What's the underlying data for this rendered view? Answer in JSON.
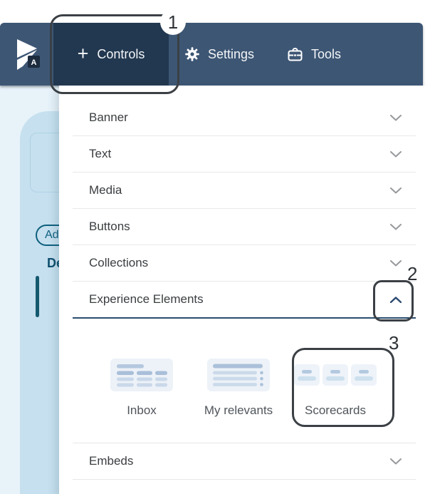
{
  "navbar": {
    "logo_badge": "A",
    "plus_glyph": "+",
    "tabs": [
      {
        "label": "Controls",
        "icon": "plus",
        "active": true
      },
      {
        "label": "Settings",
        "icon": "gear",
        "active": false
      },
      {
        "label": "Tools",
        "icon": "toolbox",
        "active": false
      }
    ]
  },
  "panel": {
    "sections": [
      {
        "label": "Banner",
        "expanded": false
      },
      {
        "label": "Text",
        "expanded": false
      },
      {
        "label": "Media",
        "expanded": false
      },
      {
        "label": "Buttons",
        "expanded": false
      },
      {
        "label": "Collections",
        "expanded": false
      },
      {
        "label": "Experience Elements",
        "expanded": true
      },
      {
        "label": "Embeds",
        "expanded": false
      }
    ],
    "experience_elements": {
      "items": [
        {
          "label": "Inbox",
          "icon": "inbox-grid-icon"
        },
        {
          "label": "My relevants",
          "icon": "list-rows-icon"
        },
        {
          "label": "Scorecards",
          "icon": "scorecards-icon"
        }
      ]
    }
  },
  "background_page": {
    "add_button_text": "Ad",
    "heading_text": "De"
  },
  "annotations": {
    "step_1": "1",
    "step_2": "2",
    "step_3": "3"
  },
  "colors": {
    "navbar": "#3d5674",
    "navbar_active_tab": "#223850",
    "accent_teal": "#0e5f7e",
    "expanded_divider": "#2a4e6e",
    "annotation_stroke": "#3b4045",
    "left_card": "#c6e0ef",
    "left_bg": "#e7f2f9",
    "icon_bar_dark": "#a9bfd9",
    "icon_bar_light": "#c9d8e9",
    "icon_tile_bg": "#edf2f8"
  }
}
